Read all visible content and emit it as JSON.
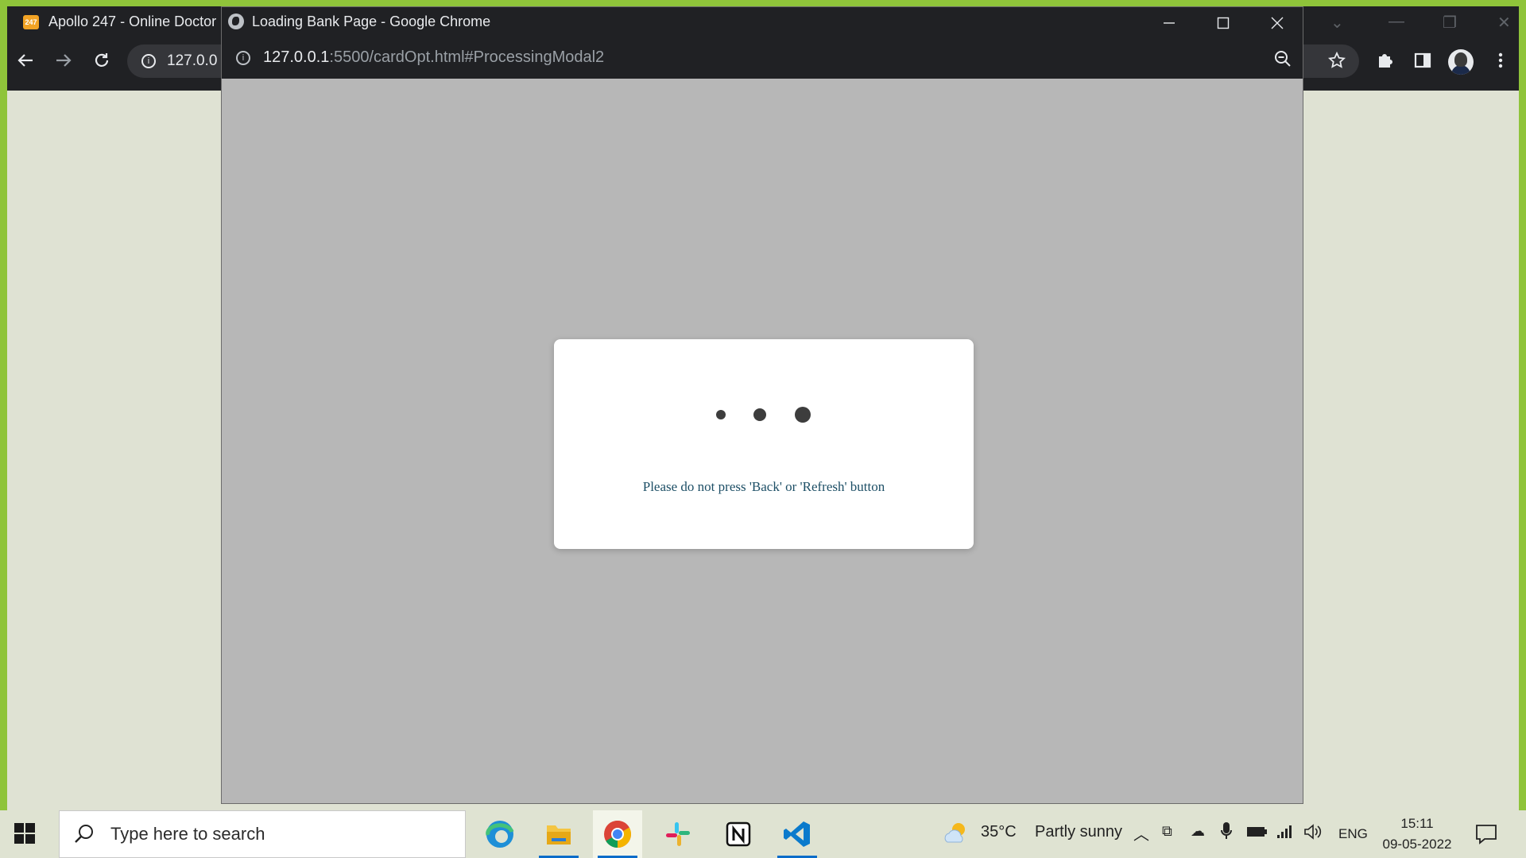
{
  "background_window": {
    "tab_title": "Apollo 247 - Online Doctor",
    "tab_favicon_text": "247",
    "omnibox_text": "127.0.0"
  },
  "popup": {
    "title": "Loading Bank Page - Google Chrome",
    "url_host": "127.0.0.1",
    "url_rest": ":5500/cardOpt.html#ProcessingModal2"
  },
  "modal": {
    "message": "Please do not press 'Back' or 'Refresh' button"
  },
  "taskbar": {
    "search_placeholder": "Type here to search",
    "weather_temp": "35°C",
    "weather_desc": "Partly sunny",
    "language": "ENG",
    "time": "15:11",
    "date": "09-05-2022"
  }
}
